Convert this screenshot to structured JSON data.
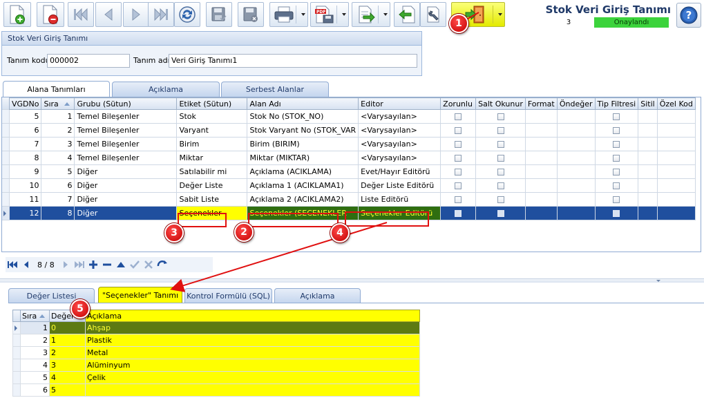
{
  "form": {
    "title": "Stok Veri Giriş Tanımı",
    "record_count": "3",
    "status": "Onaylandı"
  },
  "toolbar": {
    "buttons": [
      {
        "name": "new-icon"
      },
      {
        "name": "delete-icon"
      },
      {
        "name": "first-record-icon"
      },
      {
        "name": "previous-record-icon"
      },
      {
        "name": "next-record-icon"
      },
      {
        "name": "last-record-icon"
      },
      {
        "name": "refresh-icon"
      },
      {
        "name": "save-icon"
      },
      {
        "name": "cancel-save-icon"
      },
      {
        "name": "print-icon"
      },
      {
        "name": "pdf-export-icon"
      },
      {
        "name": "export-icon"
      },
      {
        "name": "import-icon"
      },
      {
        "name": "tools-icon"
      },
      {
        "name": "exit-icon"
      }
    ]
  },
  "header": {
    "caption": "Stok Veri Giriş Tanımı",
    "code_label": "Tanım kodu",
    "code_value": "000002",
    "name_label": "Tanım adı",
    "name_value": "Veri Giriş Tanımı1"
  },
  "top_tabs": [
    {
      "label": "Alana Tanımları",
      "active": true
    },
    {
      "label": "Açıklama",
      "active": false
    },
    {
      "label": "Serbest Alanlar",
      "active": false
    }
  ],
  "grid": {
    "columns": [
      "VGDNo",
      "Sıra",
      "Grubu (Sütun)",
      "Etiket (Sütun)",
      "Alan Adı",
      "Editor",
      "Zorunlu",
      "Salt Okunur",
      "Format",
      "Öndeğer",
      "Tip Filtresi",
      "Sitil",
      "Özel Kod"
    ],
    "rows": [
      {
        "vgdno": "5",
        "sira": "1",
        "grubu": "Temel Bileşenler",
        "etiket": "Stok",
        "alan": "Stok No (STOK_NO)",
        "editor": "<Varysayılan>"
      },
      {
        "vgdno": "6",
        "sira": "2",
        "grubu": "Temel Bileşenler",
        "etiket": "Varyant",
        "alan": "Stok Varyant No (STOK_VAR",
        "editor": "<Varysayılan>"
      },
      {
        "vgdno": "7",
        "sira": "3",
        "grubu": "Temel Bileşenler",
        "etiket": "Birim",
        "alan": "Birim (BIRIM)",
        "editor": "<Varysayılan>"
      },
      {
        "vgdno": "8",
        "sira": "4",
        "grubu": "Temel Bileşenler",
        "etiket": "Miktar",
        "alan": "Miktar (MIKTAR)",
        "editor": "<Varysayılan>"
      },
      {
        "vgdno": "9",
        "sira": "5",
        "grubu": "Diğer",
        "etiket": "Satılabilir mi",
        "alan": "Açıklama (ACIKLAMA)",
        "editor": "Evet/Hayır Editörü"
      },
      {
        "vgdno": "10",
        "sira": "6",
        "grubu": "Diğer",
        "etiket": "Değer Liste",
        "alan": "Açıklama 1 (ACIKLAMA1)",
        "editor": "Değer Liste Editörü"
      },
      {
        "vgdno": "11",
        "sira": "7",
        "grubu": "Diğer",
        "etiket": "Sabit Liste",
        "alan": "Açıklama 2 (ACIKLAMA2)",
        "editor": "Liste Editörü"
      },
      {
        "vgdno": "12",
        "sira": "8",
        "grubu": "Diğer",
        "etiket": "Seçenekler",
        "alan": "Seçenekler (SECENEKLER",
        "editor": "Seçenekler Editörü"
      }
    ]
  },
  "navigator": {
    "position": "8 / 8"
  },
  "bottom_tabs": [
    {
      "label": "Değer Listesi",
      "active": false
    },
    {
      "label": "\"Seçenekler\" Tanımı",
      "active": true
    },
    {
      "label": "Kontrol Formülü (SQL)",
      "active": false
    },
    {
      "label": "Açıklama",
      "active": false
    }
  ],
  "options_grid": {
    "columns": [
      "Sıra",
      "Değer",
      "Açıklama"
    ],
    "rows": [
      {
        "sira": "1",
        "deger": "0",
        "aciklama": "Ahşap"
      },
      {
        "sira": "2",
        "deger": "1",
        "aciklama": "Plastik"
      },
      {
        "sira": "3",
        "deger": "2",
        "aciklama": "Metal"
      },
      {
        "sira": "4",
        "deger": "3",
        "aciklama": "Alüminyum"
      },
      {
        "sira": "5",
        "deger": "4",
        "aciklama": "Çelik"
      },
      {
        "sira": "6",
        "deger": "5",
        "aciklama": ""
      }
    ]
  },
  "callouts": [
    "1",
    "2",
    "3",
    "4",
    "5"
  ],
  "colors": {
    "selection": "#1f4f9e",
    "highlight_yellow": "#ffff00",
    "highlight_green": "#2f6e10",
    "status_green": "#3cd33c",
    "callout_red": "#d40000"
  }
}
